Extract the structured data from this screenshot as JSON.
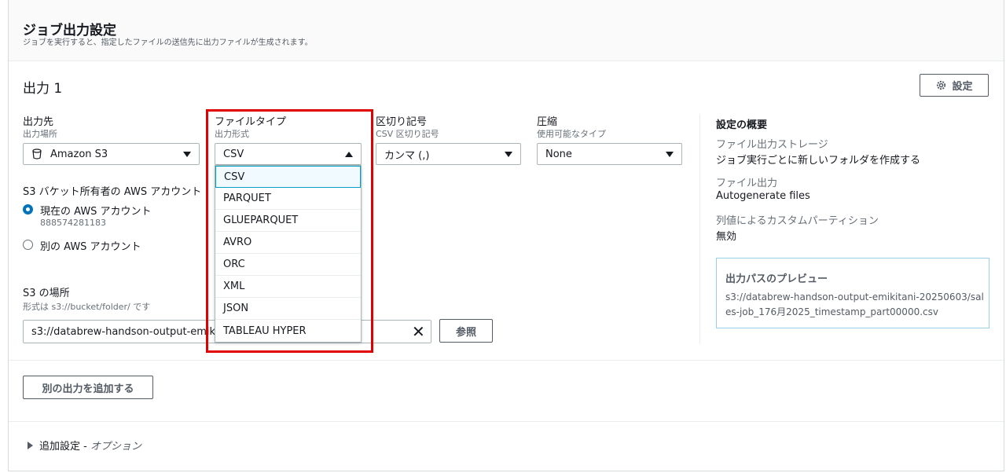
{
  "header": {
    "title": "ジョブ出力設定",
    "description": "ジョブを実行すると、指定したファイルの送信先に出力ファイルが生成されます。"
  },
  "output": {
    "title": "出力 1",
    "settings_label": "設定"
  },
  "destination": {
    "label": "出力先",
    "sub": "出力場所",
    "value": "Amazon S3"
  },
  "file_type": {
    "label": "ファイルタイプ",
    "sub": "出力形式",
    "value": "CSV",
    "options": [
      "CSV",
      "PARQUET",
      "GLUEPARQUET",
      "AVRO",
      "ORC",
      "XML",
      "JSON",
      "TABLEAU HYPER"
    ]
  },
  "delimiter": {
    "label": "区切り記号",
    "sub": "CSV 区切り記号",
    "value": "カンマ (,)"
  },
  "compression": {
    "label": "圧縮",
    "sub": "使用可能なタイプ",
    "value": "None"
  },
  "owner": {
    "label": "S3 バケット所有者の AWS アカウント",
    "current_label": "現在の AWS アカウント",
    "current_id": "888574281183",
    "other_label": "別の AWS アカウント"
  },
  "s3_location": {
    "label": "S3 の場所",
    "sub": "形式は s3://bucket/folder/ です",
    "value": "s3://databrew-handson-output-emikitani-20250603/",
    "browse_label": "参照"
  },
  "summary": {
    "title": "設定の概要",
    "storage_key": "ファイル出力ストレージ",
    "storage_val": "ジョブ実行ごとに新しいフォルダを作成する",
    "output_key": "ファイル出力",
    "output_val": "Autogenerate files",
    "partition_key": "列値によるカスタムパーティション",
    "partition_val": "無効",
    "preview_title": "出力パスのプレビュー",
    "preview_path": "s3://databrew-handson-output-emikitani-20250603/sales-job_176月2025_timestamp_part00000.csv"
  },
  "add_output_label": "別の出力を追加する",
  "advanced": {
    "label": "追加設定",
    "separator": " - ",
    "optional": "オプション"
  }
}
